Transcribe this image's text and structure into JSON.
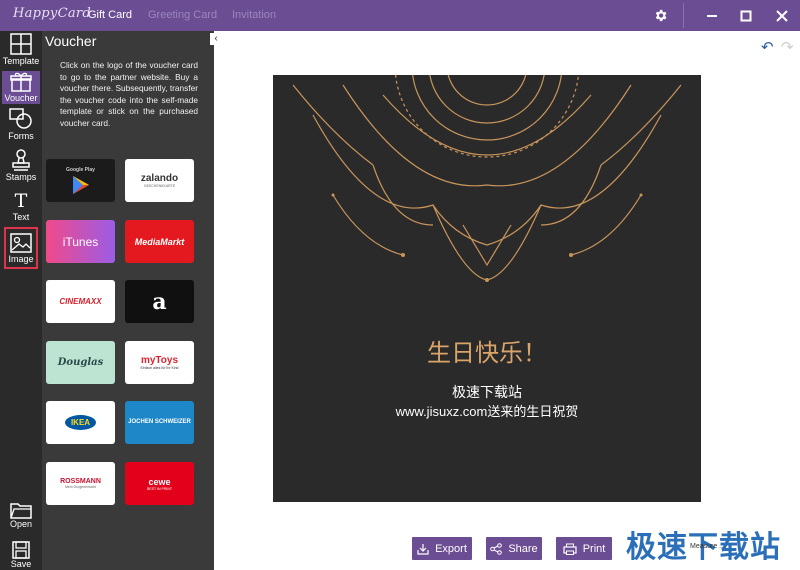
{
  "app": {
    "logo": "HappyCard",
    "tabs": [
      {
        "label": "Gift Card",
        "state": "active"
      },
      {
        "label": "Greeting Card",
        "state": "disabled"
      },
      {
        "label": "Invitation",
        "state": "disabled"
      }
    ]
  },
  "window_controls": {
    "settings": "gear-icon",
    "minimize": "minimize-icon",
    "maximize": "maximize-icon",
    "close": "close-icon"
  },
  "rail": {
    "items": [
      {
        "label": "Template",
        "icon": "grid-icon"
      },
      {
        "label": "Voucher",
        "icon": "gift-icon",
        "active": true
      },
      {
        "label": "Forms",
        "icon": "shapes-icon"
      },
      {
        "label": "Stamps",
        "icon": "stamp-icon"
      },
      {
        "label": "Text",
        "icon": "text-icon"
      },
      {
        "label": "Image",
        "icon": "image-icon",
        "highlighted": true
      }
    ],
    "bottom": [
      {
        "label": "Open",
        "icon": "folder-icon"
      },
      {
        "label": "Save",
        "icon": "save-icon"
      }
    ]
  },
  "panel": {
    "title": "Voucher",
    "description": "Click on the logo of the voucher card to go to the partner website. Buy a voucher there. Subsequently, transfer the voucher code into the self-made template or stick on the purchased voucher card.",
    "vouchers": [
      {
        "label": "Google Play",
        "brand": "google-play"
      },
      {
        "label": "zalando",
        "sub": "GESCHENKKARTE",
        "brand": "zalando"
      },
      {
        "label": "iTunes",
        "brand": "itunes"
      },
      {
        "label": "MediaMarkt",
        "brand": "mediamarkt"
      },
      {
        "label": "CINEMAXX",
        "brand": "cinemaxx"
      },
      {
        "label": "a",
        "brand": "amazon"
      },
      {
        "label": "Douglas",
        "brand": "douglas"
      },
      {
        "label": "myToys",
        "sub": "Einfach alles für Ihr Kind",
        "brand": "mytoys"
      },
      {
        "label": "IKEA",
        "brand": "ikea"
      },
      {
        "label": "JOCHEN SCHWEIZER",
        "brand": "jochen-schweizer"
      },
      {
        "label": "ROSSMANN",
        "sub": "Mein Drogeriemarkt",
        "brand": "rossmann"
      },
      {
        "label": "cewe",
        "sub": "BEST IN PRINT",
        "brand": "cewe"
      }
    ]
  },
  "card": {
    "title": "生日快乐！",
    "line1": "极速下载站",
    "line2": "www.jisuxz.com送来的生日祝贺",
    "background": "#2b2a2b",
    "accent": "#d9a46a"
  },
  "actions": [
    {
      "label": "Export",
      "icon": "export-icon"
    },
    {
      "label": "Share",
      "icon": "share-icon"
    },
    {
      "label": "Print",
      "icon": "print-icon"
    }
  ],
  "watermark": "极速下载站",
  "measure_text": "Measure ... ",
  "colors": {
    "brand": "#6b4d94",
    "rail": "#2a2a2a",
    "panel": "#3a3a3a",
    "highlight": "#e0324a"
  }
}
